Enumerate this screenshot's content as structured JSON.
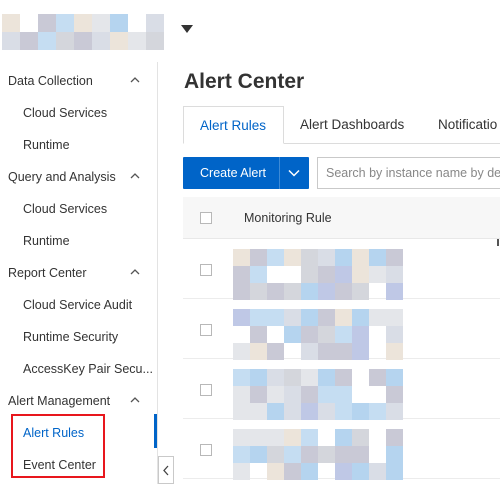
{
  "sidebar": {
    "groups": [
      {
        "label": "Data Collection",
        "items": [
          "Cloud Services",
          "Runtime"
        ]
      },
      {
        "label": "Query and Analysis",
        "items": [
          "Cloud Services",
          "Runtime"
        ]
      },
      {
        "label": "Report Center",
        "items": [
          "Cloud Service Audit",
          "Runtime Security",
          "AccessKey Pair Secu..."
        ]
      },
      {
        "label": "Alert Management",
        "items": [
          "Alert Rules",
          "Event Center"
        ]
      }
    ],
    "active_item": "Alert Rules"
  },
  "main": {
    "title": "Alert Center",
    "tabs": [
      {
        "label": "Alert Rules",
        "active": true
      },
      {
        "label": "Alert Dashboards",
        "active": false
      },
      {
        "label": "Notificatio",
        "active": false
      }
    ],
    "create_alert_label": "Create Alert",
    "search_placeholder": "Search by instance name by defa",
    "table": {
      "columns": [
        "Monitoring Rule"
      ],
      "row_count": 4
    }
  },
  "colors": {
    "accent": "#0064c8",
    "highlight": "#e8171d",
    "mosaic_palette": [
      "#c5ddf2",
      "#d9dde6",
      "#e4e6ea",
      "#c9c9d6",
      "#ece4da",
      "#b5d4ef",
      "#bfc8e6",
      "#d4d6dc"
    ]
  },
  "icons": {
    "topbar_dropdown": "caret-down-icon",
    "group_toggle": "chevron-up-icon",
    "create_alert_menu": "chevron-down-icon",
    "collapse": "chevron-left-icon"
  }
}
